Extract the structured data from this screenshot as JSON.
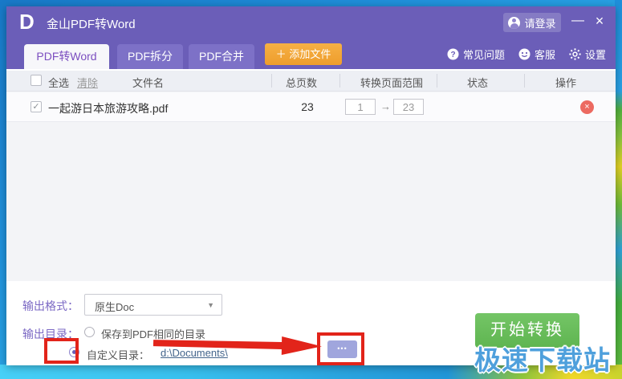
{
  "window": {
    "logo": "D",
    "title": "金山PDF转Word",
    "login_label": "请登录",
    "minimize_glyph": "—",
    "close_glyph": "×"
  },
  "tabs": [
    {
      "label": "PDF转Word",
      "active": true
    },
    {
      "label": "PDF拆分",
      "active": false
    },
    {
      "label": "PDF合并",
      "active": false
    }
  ],
  "toolbar": {
    "plus_glyph": "＋",
    "add_file_label": "添加文件",
    "faq": "常见问题",
    "support": "客服",
    "settings": "设置"
  },
  "list": {
    "select_all": "全选",
    "clear": "清除",
    "col_filename": "文件名",
    "col_pages": "总页数",
    "col_range": "转换页面范围",
    "col_status": "状态",
    "col_action": "操作"
  },
  "rows": [
    {
      "filename": "一起游日本旅游攻略.pdf",
      "total_pages": "23",
      "range_from": "1",
      "range_arrow": "→",
      "range_to": "23",
      "status": "",
      "check_glyph": "✓",
      "delete_glyph": "×"
    }
  ],
  "output": {
    "format_label": "输出格式：",
    "format_value": "原生Doc",
    "caret_glyph": "▼",
    "dir_label": "输出目录：",
    "same_dir_option": "保存到PDF相同的目录",
    "custom_dir_option": "自定义目录：",
    "custom_path": "d:\\Documents\\",
    "browse_glyph": "•••"
  },
  "actions": {
    "convert": "开始转换"
  },
  "watermark": {
    "text": "极速下载站"
  },
  "colors": {
    "titlebar_purple": "#6b5eb8",
    "tab_inactive_purple": "#7d71c7",
    "active_tab_text": "#7c4fc0",
    "add_button_orange": "#f2a33c",
    "convert_green": "#67bd59",
    "annotation_red": "#e2241a",
    "delete_red": "#ec6a61",
    "label_purple": "#7b68c4",
    "watermark_blue": "#4fa0dc"
  }
}
